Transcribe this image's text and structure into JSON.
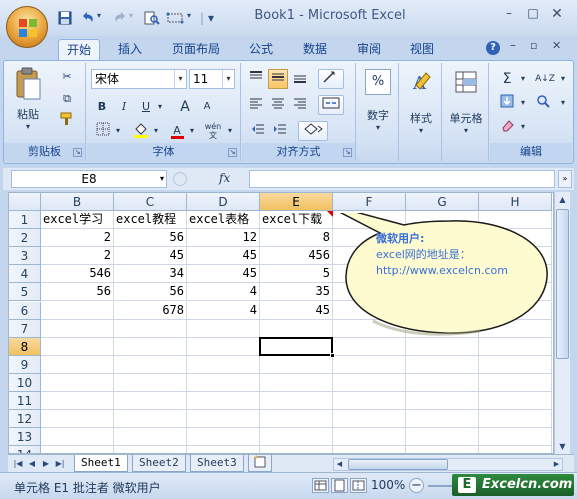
{
  "title": "Book1 - Microsoft Excel",
  "qat": {
    "save": "保存",
    "undo": "撤销",
    "redo": "恢复",
    "preview": "打印预览",
    "customize": "▾"
  },
  "tabs": [
    {
      "label": "开始"
    },
    {
      "label": "插入"
    },
    {
      "label": "页面布局"
    },
    {
      "label": "公式"
    },
    {
      "label": "数据"
    },
    {
      "label": "审阅"
    },
    {
      "label": "视图"
    }
  ],
  "ribbon": {
    "clipboard": {
      "label": "剪贴板",
      "paste": "粘贴"
    },
    "font": {
      "label": "字体",
      "name": "宋体",
      "size": "11",
      "bold": "B",
      "italic": "I",
      "underline": "U",
      "grow": "A",
      "shrink": "A",
      "color_letter": "A",
      "phonetic": "wén"
    },
    "alignment": {
      "label": "对齐方式"
    },
    "number": {
      "label": "数字"
    },
    "styles": {
      "label": "样式"
    },
    "cells": {
      "label": "单元格"
    },
    "editing": {
      "label": "编辑",
      "sum": "Σ",
      "sort": "A↓Z"
    }
  },
  "formula_bar": {
    "name_box": "E8",
    "fx": "fx",
    "content": ""
  },
  "columns": [
    "B",
    "C",
    "D",
    "E",
    "F",
    "G",
    "H"
  ],
  "rows": [
    "1",
    "2",
    "3",
    "4",
    "5",
    "6",
    "7",
    "8",
    "9",
    "10",
    "11",
    "12",
    "13",
    "14"
  ],
  "cells": {
    "r1": [
      "excel学习",
      "excel教程",
      "excel表格",
      "excel下载",
      "",
      "",
      ""
    ],
    "r2": [
      "2",
      "56",
      "12",
      "8",
      "",
      "",
      ""
    ],
    "r3": [
      "2",
      "45",
      "45",
      "456",
      "",
      "",
      ""
    ],
    "r4": [
      "546",
      "34",
      "45",
      "5",
      "",
      "",
      ""
    ],
    "r5": [
      "56",
      "56",
      "4",
      "35",
      "",
      "",
      ""
    ],
    "r6": [
      "",
      "678",
      "4",
      "45",
      "",
      "",
      ""
    ]
  },
  "comment": {
    "author": "微软用户:",
    "line1": "excel网的地址是：",
    "line2": "http://www.excelcn.com"
  },
  "sheets": [
    {
      "label": "Sheet1"
    },
    {
      "label": "Sheet2"
    },
    {
      "label": "Sheet3"
    }
  ],
  "status": {
    "text": "单元格 E1 批注者 微软用户",
    "zoom": "100%"
  },
  "brand": {
    "logo": "E",
    "text": "Excelcn.com"
  },
  "colors": {
    "ribbon_bg": "#dbe6f6",
    "selected_header": "#f5c96a",
    "comment_bg": "#fdfbcf",
    "comment_text": "#3a6fd8",
    "brand_bg": "#1f6b2e"
  }
}
